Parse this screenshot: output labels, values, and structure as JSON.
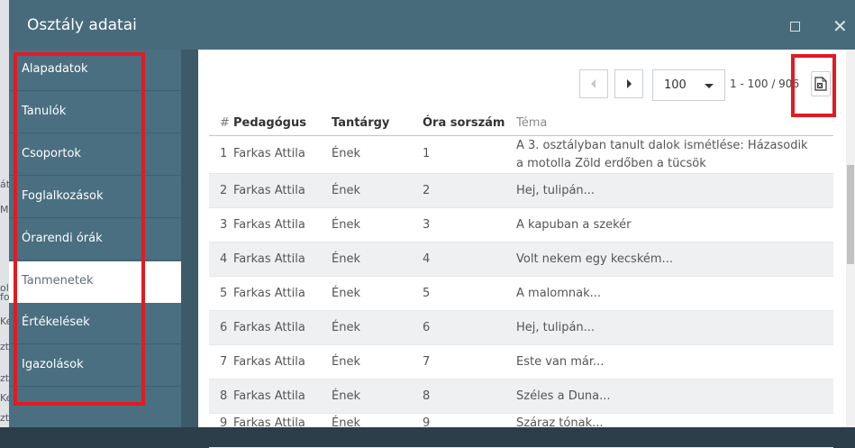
{
  "dialog": {
    "title": "Osztály adatai"
  },
  "background": {
    "fragments": [
      "át",
      "M",
      "ol",
      "fo",
      "Ké",
      "zt",
      "zt",
      "Ké",
      "zt"
    ]
  },
  "sidebar": {
    "items": [
      {
        "label": "Alapadatok"
      },
      {
        "label": "Tanulók"
      },
      {
        "label": "Csoportok"
      },
      {
        "label": "Foglalkozások"
      },
      {
        "label": "Órarendi órák"
      },
      {
        "label": "Tanmenetek"
      },
      {
        "label": "Értékelések"
      },
      {
        "label": "Igazolások"
      }
    ],
    "active": "Tanmenetek"
  },
  "pager": {
    "page_size": "100",
    "range": "1 - 100 / 906"
  },
  "table": {
    "headers": {
      "num": "#",
      "pedagogus": "Pedagógus",
      "tantargy": "Tantárgy",
      "ora": "Óra sorszám",
      "tema": "Téma"
    },
    "rows": [
      {
        "num": "1",
        "pedagogus": "Farkas Attila",
        "tantargy": "Ének",
        "ora": "1",
        "tema": "A 3. osztályban tanult dalok ismétlése: Házasodik a motolla Zöld erdőben a tücsök"
      },
      {
        "num": "2",
        "pedagogus": "Farkas Attila",
        "tantargy": "Ének",
        "ora": "2",
        "tema": "Hej, tulipán..."
      },
      {
        "num": "3",
        "pedagogus": "Farkas Attila",
        "tantargy": "Ének",
        "ora": "3",
        "tema": "A kapuban a szekér"
      },
      {
        "num": "4",
        "pedagogus": "Farkas Attila",
        "tantargy": "Ének",
        "ora": "4",
        "tema": "Volt nekem egy kecském..."
      },
      {
        "num": "5",
        "pedagogus": "Farkas Attila",
        "tantargy": "Ének",
        "ora": "5",
        "tema": "A malomnak..."
      },
      {
        "num": "6",
        "pedagogus": "Farkas Attila",
        "tantargy": "Ének",
        "ora": "6",
        "tema": "Hej, tulipán..."
      },
      {
        "num": "7",
        "pedagogus": "Farkas Attila",
        "tantargy": "Ének",
        "ora": "7",
        "tema": "Este van már..."
      },
      {
        "num": "8",
        "pedagogus": "Farkas Attila",
        "tantargy": "Ének",
        "ora": "8",
        "tema": "Széles a Duna..."
      },
      {
        "num": "9",
        "pedagogus": "Farkas Attila",
        "tantargy": "Ének",
        "ora": "9",
        "tema": "Száraz tónak..."
      }
    ]
  },
  "colors": {
    "highlight_border": "#e01b24",
    "dialog_bg": "#3d5a69",
    "sidebar_bg": "#4a6f80"
  }
}
